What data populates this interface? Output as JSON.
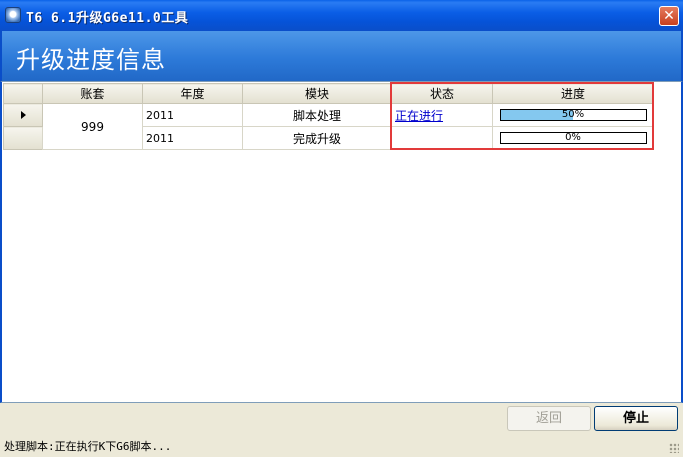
{
  "window": {
    "title": "T6 6.1升级G6e11.0工具",
    "close_glyph": "✕"
  },
  "banner": {
    "title": "升级进度信息"
  },
  "grid": {
    "columns": [
      "账套",
      "年度",
      "模块",
      "状态",
      "进度"
    ],
    "rows": [
      {
        "account": "999",
        "year": "2011",
        "module": "脚本处理",
        "status": "正在进行",
        "progress_label": "50%",
        "progress": 0.5,
        "selected": true
      },
      {
        "account": "",
        "year": "2011",
        "module": "完成升级",
        "status": "",
        "progress_label": "0%",
        "progress": 0.0,
        "selected": false
      }
    ]
  },
  "buttons": {
    "back": "返回",
    "stop": "停止"
  },
  "status_bar": {
    "text": "处理脚本:正在执行K下G6脚本..."
  },
  "colors": {
    "title_bar": "#0653d8",
    "banner": "#2d7ad9",
    "progress_fill": "#84c8ef",
    "highlight": "#e23a3a"
  }
}
